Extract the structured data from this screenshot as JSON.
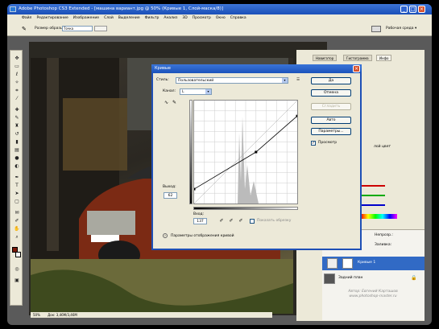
{
  "window": {
    "title": "Adobe Photoshop CS3 Extended - [машина вариант.jpg @ 50% (Кривые 1, Слой-маска/8)]"
  },
  "menu": {
    "items": [
      "Файл",
      "Редактирование",
      "Изображение",
      "Слой",
      "Выделение",
      "Фильтр",
      "Анализ",
      "3D",
      "Просмотр",
      "Окно",
      "Справка"
    ]
  },
  "options": {
    "sample_label": "Размер образца:",
    "sample_value": "Точка",
    "workspace_label": "Рабочая среда ▾"
  },
  "status": {
    "zoom": "50%",
    "doc_info": "Док: 3,46М/3,46М"
  },
  "curves_dialog": {
    "title": "Кривые",
    "preset_label": "Стиль:",
    "preset_value": "Пользовательский",
    "channel_label": "Канал:",
    "channel_value": "L",
    "output_label": "Выход:",
    "output_value": "62",
    "input_label": "Вход:",
    "input_value": "137",
    "show_clipping_label": "Показать обрезку",
    "show_clipping_checked": false,
    "display_options_label": "Параметры отображения кривой",
    "buttons": {
      "ok": "Да",
      "cancel": "Отмена",
      "smooth": "Сгладить",
      "auto": "Авто",
      "options": "Параметры..."
    },
    "preview_label": "Просмотр",
    "preview_checked": true,
    "curve_points": [
      [
        0,
        0.14
      ],
      [
        0.6,
        0.5
      ],
      [
        1.0,
        0.85
      ]
    ]
  },
  "panels": {
    "tabs": [
      "Навигатор",
      "Гистограмма",
      "Инфо"
    ],
    "active_tab": "Инфо",
    "side_text": "лой цвет"
  },
  "layers": {
    "opacity_label": "Непрозр.:",
    "fill_label": "Заливка:",
    "items": [
      {
        "name": "Кривые 1",
        "selected": true
      },
      {
        "name": "Задний план",
        "selected": false
      }
    ]
  },
  "watermark": {
    "author": "Автор: Евгений Карташов",
    "site": "www.photoshop-master.ru"
  },
  "colors": {
    "titlebar": "#1a4fb8",
    "selection": "#316ac5",
    "foreground_swatch": "#7a1a0a"
  }
}
